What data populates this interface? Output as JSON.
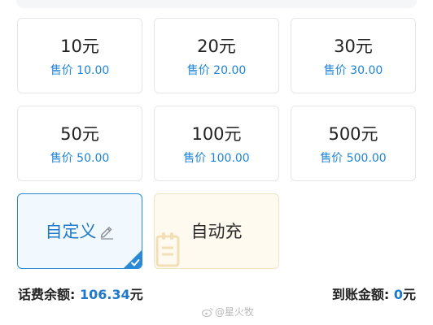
{
  "amount_options": [
    {
      "amount": "10元",
      "price": "售价 10.00"
    },
    {
      "amount": "20元",
      "price": "售价 20.00"
    },
    {
      "amount": "30元",
      "price": "售价 30.00"
    },
    {
      "amount": "50元",
      "price": "售价 50.00"
    },
    {
      "amount": "100元",
      "price": "售价 100.00"
    },
    {
      "amount": "500元",
      "price": "售价 500.00"
    }
  ],
  "custom_option": {
    "label": "自定义",
    "icon": "pencil-icon",
    "selected": true
  },
  "auto_option": {
    "label": "自动充",
    "icon": "notepad-icon"
  },
  "balance": {
    "label": "话费余额:",
    "value": "106.34",
    "unit": "元"
  },
  "credited": {
    "label": "到账金额:",
    "value": "0",
    "unit": "元"
  },
  "watermark": {
    "text": "@星火牧",
    "icon": "weibo-icon"
  },
  "colors": {
    "accent": "#1f78c9",
    "price": "#1f84d6",
    "selected_bg": "#f1f8fe",
    "auto_bg": "#fffaf0"
  }
}
